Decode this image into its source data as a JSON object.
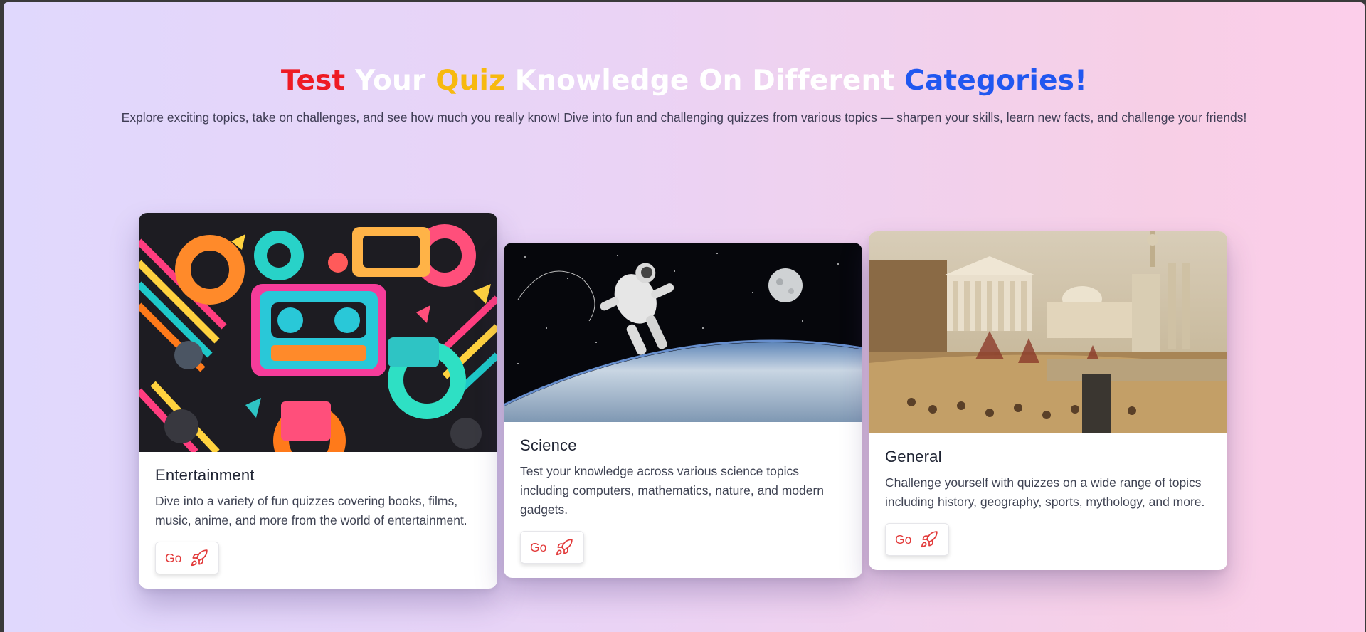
{
  "hero": {
    "title_words": [
      "Test",
      "Your",
      "Quiz",
      "Knowledge On Different",
      "Categories!"
    ],
    "subtitle": "Explore exciting topics, take on challenges, and see how much you really know! Dive into fun and challenging quizzes from various topics — sharpen your skills, learn new facts, and challenge your friends!"
  },
  "colors": {
    "red": "#ee1b24",
    "yellow": "#f7b90f",
    "blue": "#2157f0",
    "button_text": "#e23a3a"
  },
  "cards": [
    {
      "title": "Entertainment",
      "description": "Dive into a variety of fun quizzes covering books, films, music, anime, and more from the world of entertainment.",
      "button_label": "Go",
      "button_icon": "rocket-icon",
      "image": "retro-cassette-pattern"
    },
    {
      "title": "Science",
      "description": "Test your knowledge across various science topics including computers, mathematics, nature, and modern gadgets.",
      "button_label": "Go",
      "button_icon": "rocket-icon",
      "image": "astronaut-over-earth"
    },
    {
      "title": "General",
      "description": "Challenge yourself with quizzes on a wide range of topics including history, geography, sports, mythology, and more.",
      "button_label": "Go",
      "button_icon": "rocket-icon",
      "image": "classical-city-painting"
    }
  ]
}
